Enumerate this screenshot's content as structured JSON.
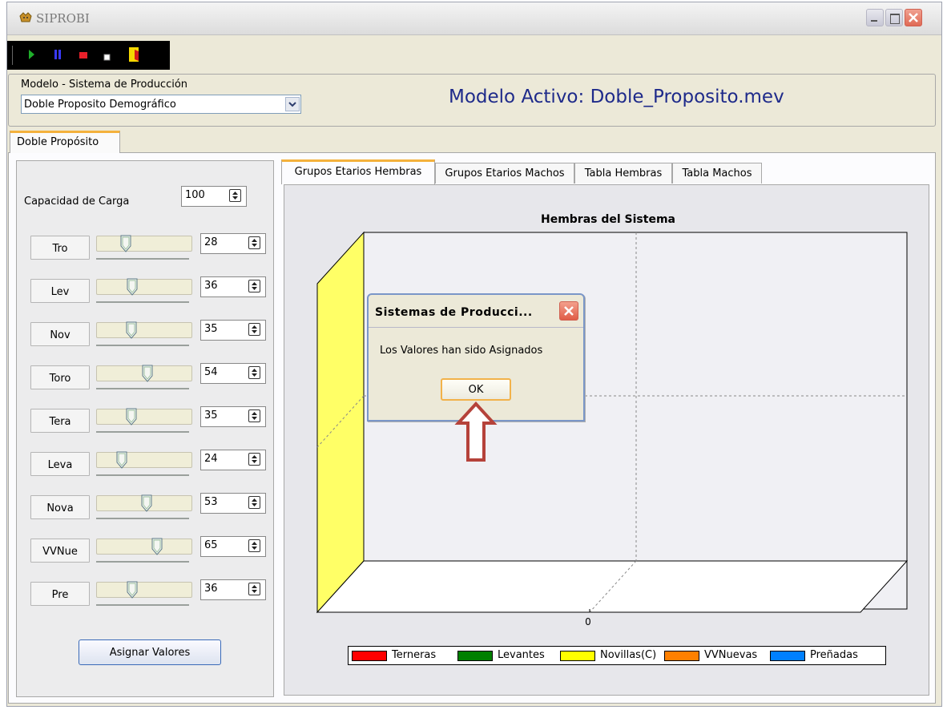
{
  "window": {
    "title": "SIPROBI",
    "icon": "bull-icon"
  },
  "toolbar": {
    "buttons": [
      "play-icon",
      "pause-icon",
      "stop-icon",
      "step-icon",
      "exit-icon"
    ]
  },
  "model": {
    "label": "Modelo - Sistema de Producción",
    "selected": "Doble Proposito Demográfico",
    "active_text": "Modelo Activo: Doble_Proposito.mev"
  },
  "main_tab": {
    "label": "Doble Propósito"
  },
  "left_panel": {
    "capacity_label": "Capacidad de Carga",
    "capacity_value": "100",
    "params": [
      {
        "label": "Tro",
        "value": "28",
        "slider_fraction": 0.28
      },
      {
        "label": "Lev",
        "value": "36",
        "slider_fraction": 0.36
      },
      {
        "label": "Nov",
        "value": "35",
        "slider_fraction": 0.35
      },
      {
        "label": "Toro",
        "value": "54",
        "slider_fraction": 0.54
      },
      {
        "label": "Tera",
        "value": "35",
        "slider_fraction": 0.35
      },
      {
        "label": "Leva",
        "value": "24",
        "slider_fraction": 0.24
      },
      {
        "label": "Nova",
        "value": "53",
        "slider_fraction": 0.53
      },
      {
        "label": "VVNue",
        "value": "65",
        "slider_fraction": 0.65
      },
      {
        "label": "Pre",
        "value": "36",
        "slider_fraction": 0.36
      }
    ],
    "assign_button": "Asignar Valores"
  },
  "chart_tabs": [
    {
      "label": "Grupos Etarios Hembras",
      "active": true
    },
    {
      "label": "Grupos Etarios Machos",
      "active": false
    },
    {
      "label": "Tabla Hembras",
      "active": false
    },
    {
      "label": "Tabla Machos",
      "active": false
    }
  ],
  "chart_data": {
    "type": "bar",
    "title": "Hembras del Sistema",
    "x_tick_labels": [
      "0"
    ],
    "series": [
      {
        "name": "Terneras",
        "color": "#ff0000",
        "values": []
      },
      {
        "name": "Levantes",
        "color": "#008000",
        "values": []
      },
      {
        "name": "Novillas(C)",
        "color": "#ffff00",
        "values": []
      },
      {
        "name": "VVNuevas",
        "color": "#ff8000",
        "values": []
      },
      {
        "name": "Preñadas",
        "color": "#0080ff",
        "values": []
      }
    ],
    "grid": true,
    "legend": "bottom"
  },
  "dialog": {
    "title": "Sistemas de Producci...",
    "message": "Los Valores han sido Asignados",
    "ok_label": "OK"
  },
  "colors": {
    "accent_tab": "#f4b13c",
    "title_text": "#1e2a8a",
    "annotation_arrow": "#b5423a",
    "wall_fill": "#ffff66"
  }
}
